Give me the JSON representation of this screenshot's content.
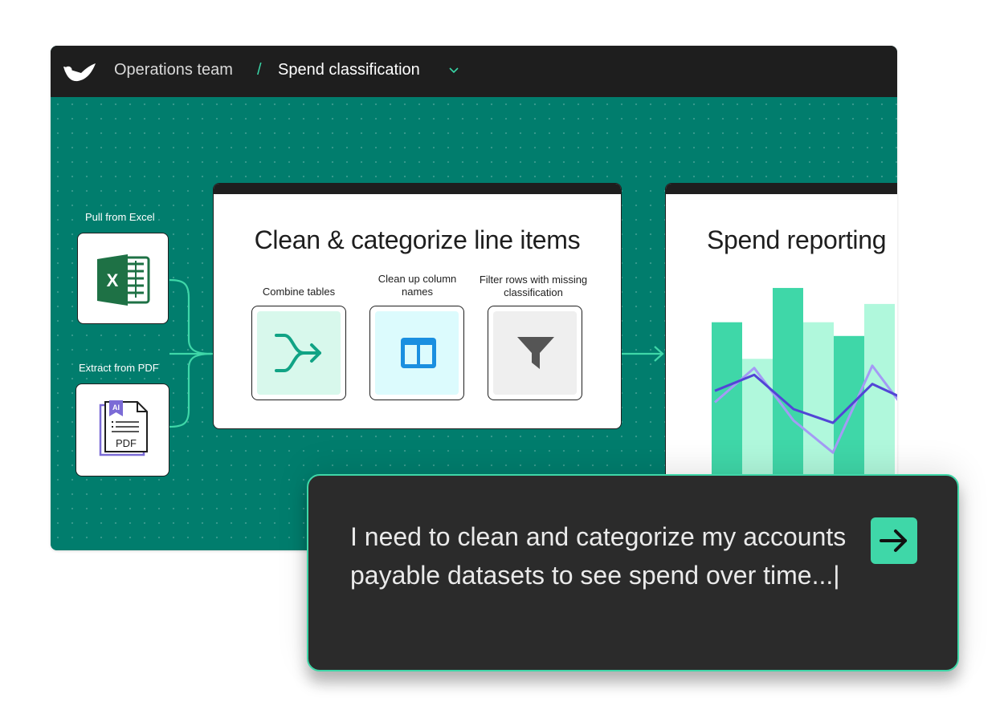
{
  "header": {
    "team": "Operations team",
    "separator": "/",
    "current_page": "Spend classification",
    "logo_icon": "brand-logo-icon",
    "dropdown_icon": "chevron-down-icon"
  },
  "sources": [
    {
      "label": "Pull from Excel",
      "icon": "excel-icon"
    },
    {
      "label": "Extract from PDF",
      "icon": "pdf-ai-icon",
      "icon_badge": "AI",
      "icon_text": "PDF"
    }
  ],
  "pipeline": {
    "title": "Clean & categorize line items",
    "steps": [
      {
        "label": "Combine tables",
        "icon": "merge-icon"
      },
      {
        "label": "Clean up column names",
        "icon": "columns-icon"
      },
      {
        "label": "Filter rows with missing classification",
        "icon": "filter-funnel-icon"
      }
    ]
  },
  "report": {
    "title": "Spend reporting",
    "chart_data": {
      "type": "bar",
      "series": [
        {
          "values": [
            0.78,
            0.62,
            0.93,
            0.78,
            0.72,
            0.86
          ]
        },
        {
          "values": [
            0.48,
            0.55,
            0.4,
            0.34,
            0.51,
            0.43
          ]
        },
        {
          "values": [
            0.43,
            0.58,
            0.35,
            0.21,
            0.59,
            0.36
          ]
        }
      ]
    }
  },
  "prompt": {
    "text": "I need to clean and categorize my accounts payable datasets to see spend over time...|",
    "send_icon": "arrow-right-icon"
  },
  "colors": {
    "canvas": "#017d6d",
    "titlebar": "#1e1e1e",
    "accent": "#3fd7a8",
    "step_merge_bg": "#d8f8ec",
    "step_columns_bg": "#dcfbfd",
    "step_filter_bg": "#efefef"
  }
}
